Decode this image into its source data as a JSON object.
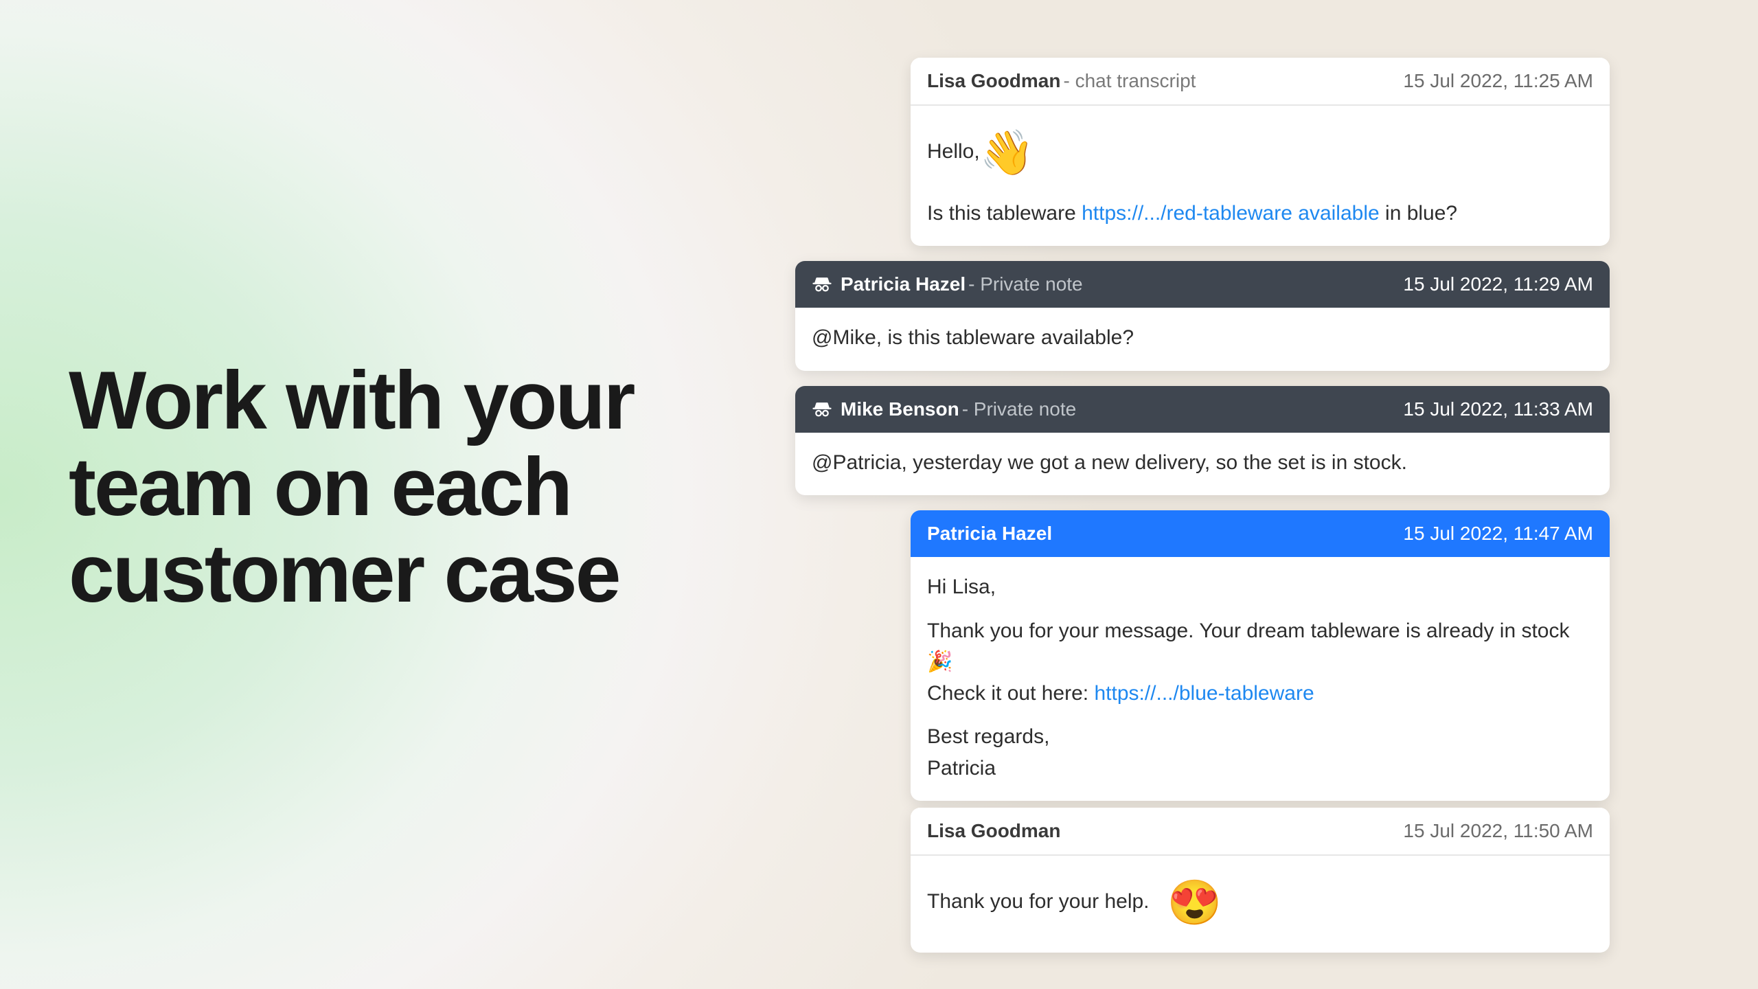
{
  "heading": {
    "line1": "Work with your",
    "line2": "team on each",
    "line3": "customer case"
  },
  "cards": {
    "c1": {
      "author": "Lisa Goodman",
      "suffix": " - chat transcript",
      "ts": "15 Jul 2022, 11:25 AM",
      "greeting_prefix": "Hello,",
      "wave": "👋",
      "q_prefix": "Is this tableware ",
      "q_link": "https://.../red-tableware available",
      "q_suffix": " in blue?"
    },
    "c2": {
      "author": "Patricia Hazel",
      "suffix": " - Private note",
      "ts": "15 Jul 2022, 11:29 AM",
      "body": "@Mike, is this tableware available?"
    },
    "c3": {
      "author": "Mike Benson",
      "suffix": " - Private note",
      "ts": "15 Jul 2022, 11:33 AM",
      "body": "@Patricia, yesterday we got a new delivery, so the set is in stock."
    },
    "c4": {
      "author": "Patricia Hazel",
      "ts": "15 Jul 2022, 11:47 AM",
      "p1": "Hi Lisa,",
      "p2_prefix": "Thank you for your message. Your dream tableware is already in stock",
      "p2_emoji": "🎉",
      "p3_prefix": "Check it out here: ",
      "p3_link": "https://.../blue-tableware",
      "p4": "Best regards,",
      "p5": "Patricia"
    },
    "c5": {
      "author": "Lisa Goodman",
      "ts": "15 Jul 2022, 11:50 AM",
      "body_prefix": "Thank you for your help. ",
      "emoji": "😍"
    }
  }
}
